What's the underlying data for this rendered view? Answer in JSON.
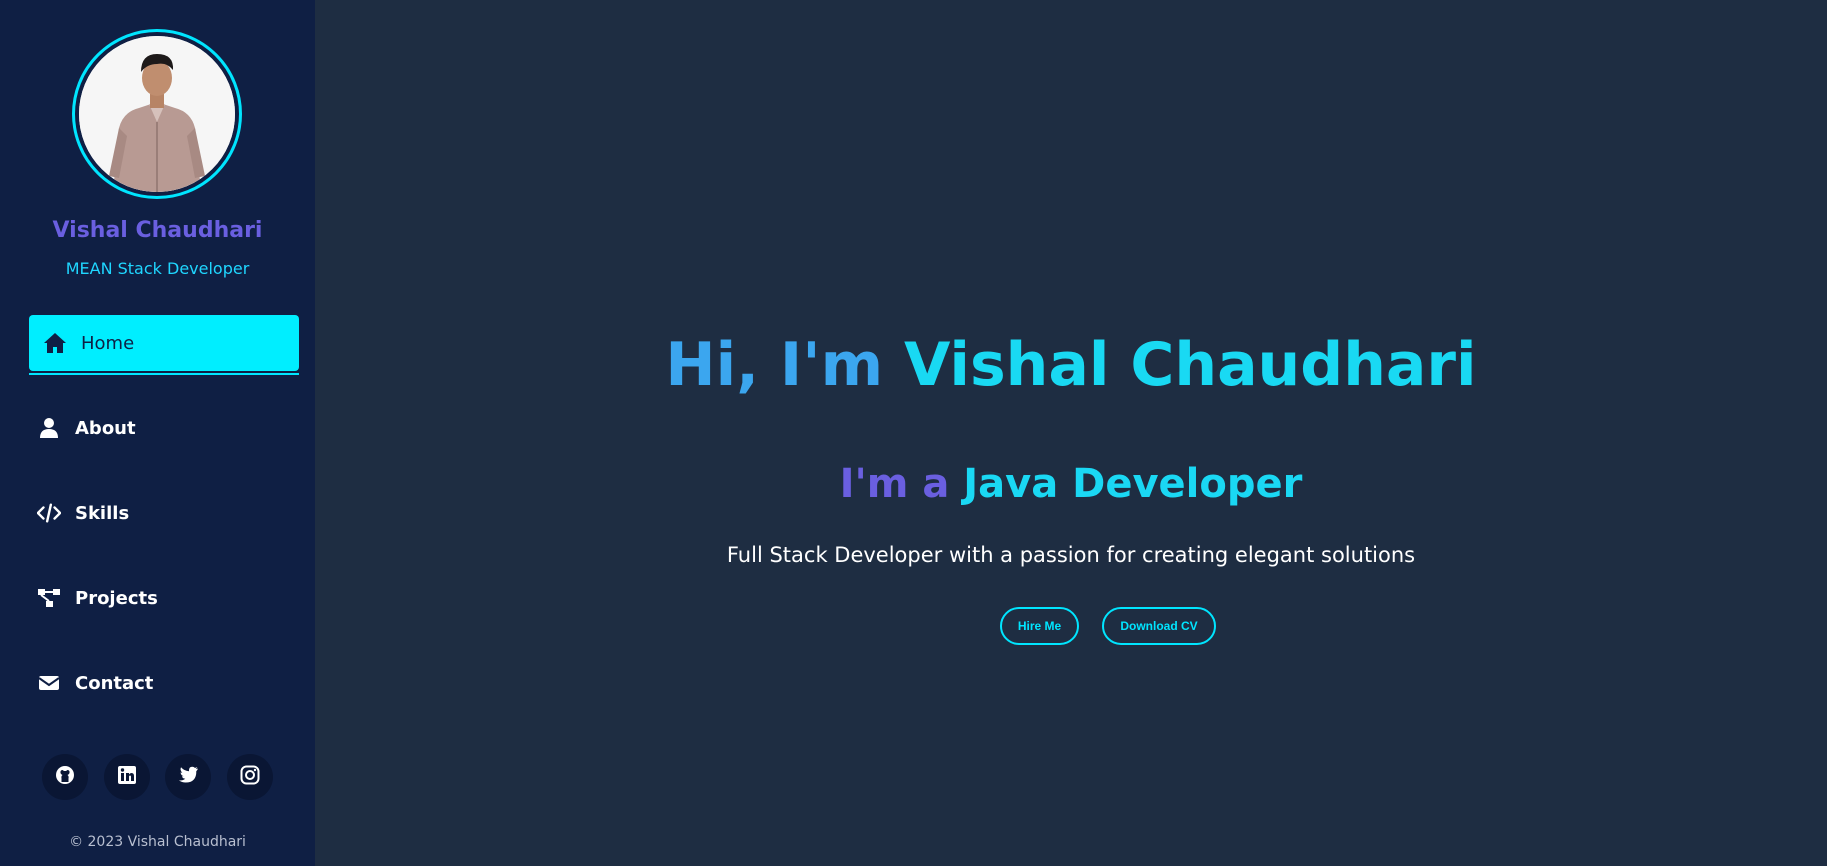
{
  "profile": {
    "name": "Vishal Chaudhari",
    "role": "MEAN Stack Developer"
  },
  "nav": {
    "items": [
      {
        "label": "Home",
        "icon": "home-icon"
      },
      {
        "label": "About",
        "icon": "user-icon"
      },
      {
        "label": "Skills",
        "icon": "code-icon"
      },
      {
        "label": "Projects",
        "icon": "project-diagram-icon"
      },
      {
        "label": "Contact",
        "icon": "envelope-icon"
      }
    ],
    "active": "Home"
  },
  "socials": [
    "github-icon",
    "linkedin-icon",
    "twitter-icon",
    "instagram-icon"
  ],
  "footer": "© 2023 Vishal Chaudhari",
  "hero": {
    "greeting": "Hi, I'm",
    "name": "Vishal Chaudhari",
    "prefix": "I'm a",
    "title": "Java Developer",
    "description": "Full Stack Developer with a passion for creating elegant solutions",
    "buttons": {
      "hire": "Hire Me",
      "cv": "Download CV"
    }
  },
  "colors": {
    "sidebar_bg": "#0f1f44",
    "main_bg": "#1e2d42",
    "accent": "#00e5ff",
    "purple": "#6a5fe0",
    "blue": "#3ba6ef"
  }
}
